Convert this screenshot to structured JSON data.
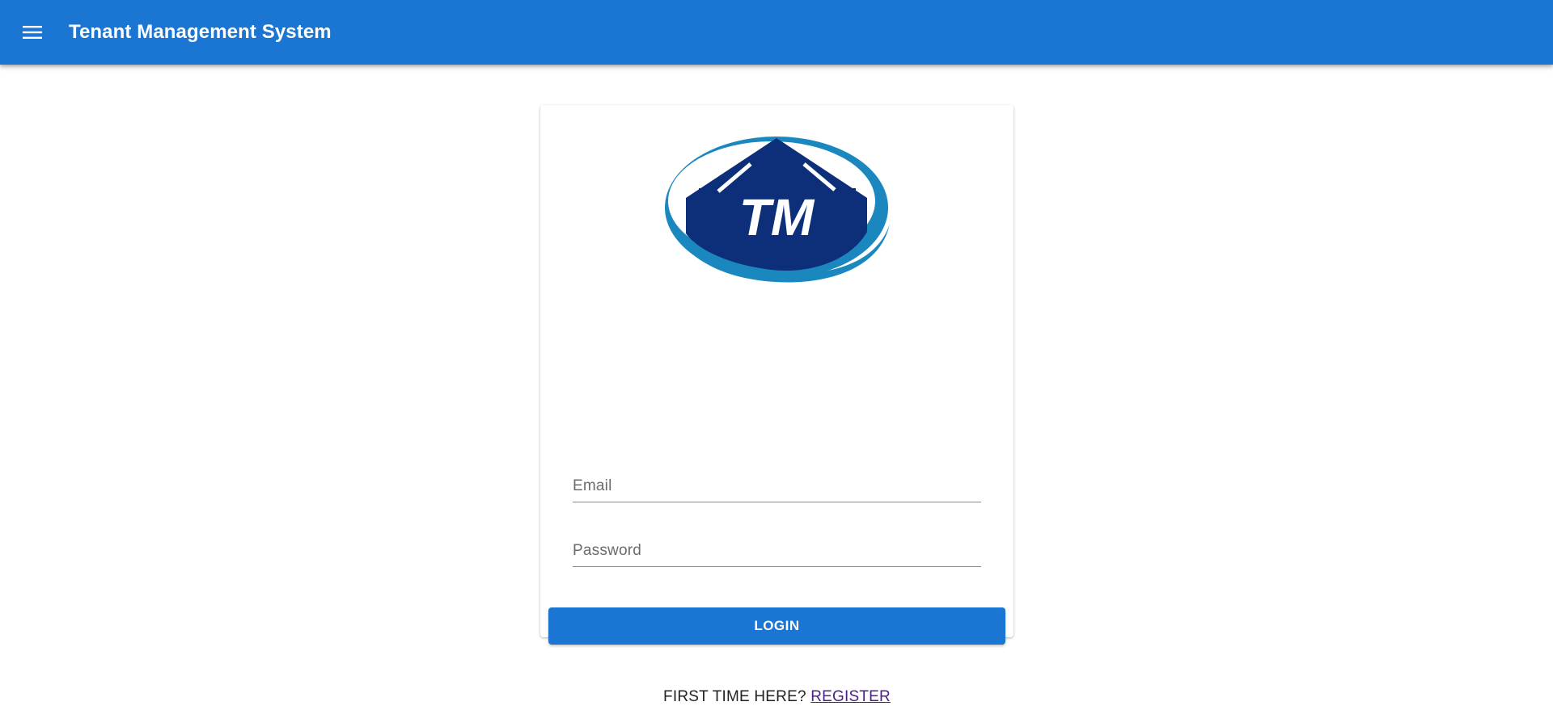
{
  "app_bar": {
    "title": "Tenant Management System",
    "menu_icon": "menu-icon",
    "background_color": "#1a76d2"
  },
  "login_card": {
    "logo": {
      "icon": "house-logo",
      "text": "TM"
    },
    "email_field": {
      "label": "Email",
      "value": ""
    },
    "password_field": {
      "label": "Password",
      "value": ""
    },
    "login_button_label": "LOGIN",
    "register_prompt": "FIRST TIME HERE?",
    "register_link": "REGISTER"
  },
  "colors": {
    "primary": "#1a76d2",
    "logo_dark_blue": "#0d2f7a",
    "logo_light_blue": "#1b87bf",
    "link": "#4b1e8c"
  }
}
